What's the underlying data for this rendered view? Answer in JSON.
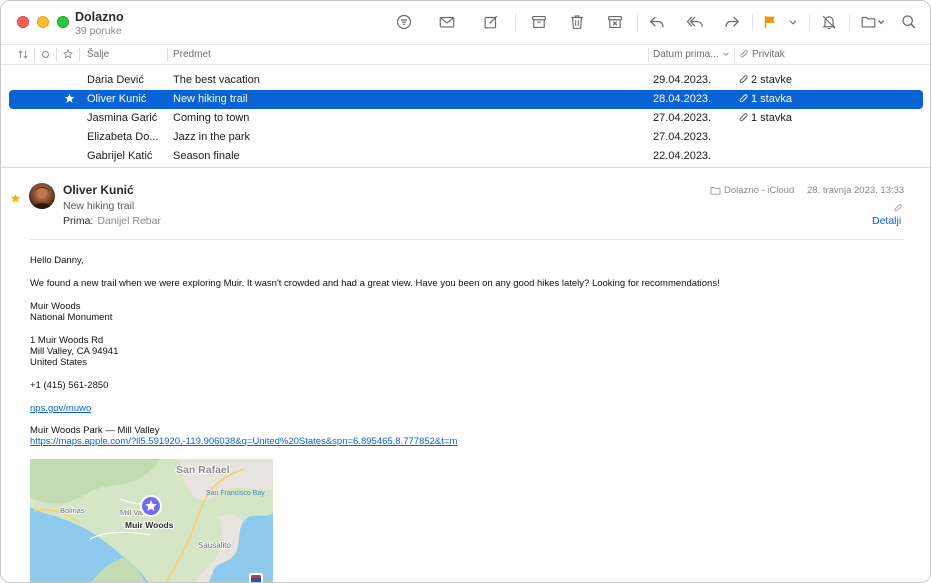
{
  "toolbar": {
    "mailbox_title": "Dolazno",
    "mailbox_subtitle": "39 poruke"
  },
  "icons": [
    "filter-icon",
    "compose-mail-icon",
    "new-note-icon",
    "archive-icon",
    "trash-icon",
    "junk-icon",
    "reply-icon",
    "reply-all-icon",
    "forward-icon",
    "flag-icon",
    "chevron-down-icon",
    "mute-bell-icon",
    "move-folder-icon",
    "search-icon",
    "paperclip-icon",
    "star-icon"
  ],
  "colors": {
    "accent": "#0a63d6",
    "flag": "#f0920c",
    "star": "#f5b800",
    "traffic_red": "#ff5f57",
    "traffic_yellow": "#febc2e",
    "traffic_green": "#28c840"
  },
  "list_header": {
    "sender": "Šalje",
    "subject": "Predmet",
    "date": "Datum prima...",
    "attachment": "Privitak"
  },
  "messages": [
    {
      "sender": "Daria Dević",
      "subject": "The best vacation",
      "date": "29.04.2023.",
      "attachments": "2 stavke",
      "starred": false,
      "selected": false
    },
    {
      "sender": "Oliver Kunić",
      "subject": "New hiking trail",
      "date": "28.04.2023.",
      "attachments": "1 stavka",
      "starred": true,
      "selected": true
    },
    {
      "sender": "Jasmina Garić",
      "subject": "Coming to town",
      "date": "27.04.2023.",
      "attachments": "1 stavka",
      "starred": false,
      "selected": false
    },
    {
      "sender": "Elizabeta Do...",
      "subject": "Jazz in the park",
      "date": "27.04.2023.",
      "attachments": "",
      "starred": false,
      "selected": false
    },
    {
      "sender": "Gabrijel Katić",
      "subject": "Season finale",
      "date": "22.04.2023.",
      "attachments": "",
      "starred": false,
      "selected": false
    }
  ],
  "message": {
    "from": "Oliver Kunić",
    "subject": "New hiking trail",
    "to_label": "Prima:",
    "to": "Danijel Rebar",
    "mailbox": "Dolazno - iCloud",
    "date": "28. travnja 2023. 13:33",
    "details": "Detalji",
    "body": {
      "greeting": "Hello Danny,",
      "paragraph": "We found a new trail when we were exploring Muir. It wasn't crowded and had a great view. Have you been on any good hikes lately? Looking for recommendations!",
      "place_name": "Muir Woods",
      "place_type": "National Monument",
      "address_1": "1 Muir Woods Rd",
      "address_2": "Mill Valley, CA 94941",
      "address_3": "United States",
      "phone": "+1 (415) 561-2850",
      "website": "nps.gov/muwo",
      "map_title": "Muir Woods Park — Mill Valley",
      "map_url": "https://maps.apple.com/?ll5.591920,-119.906038&q=United%20States&spn=6.895465,8.777852&t=m"
    },
    "map_labels": {
      "city_1": "San Rafael",
      "city_2": "San Francisco Bay",
      "town_1": "Bolinas",
      "town_2": "Mill Valley",
      "pin": "Muir Woods",
      "town_3": "Sausalito"
    }
  }
}
